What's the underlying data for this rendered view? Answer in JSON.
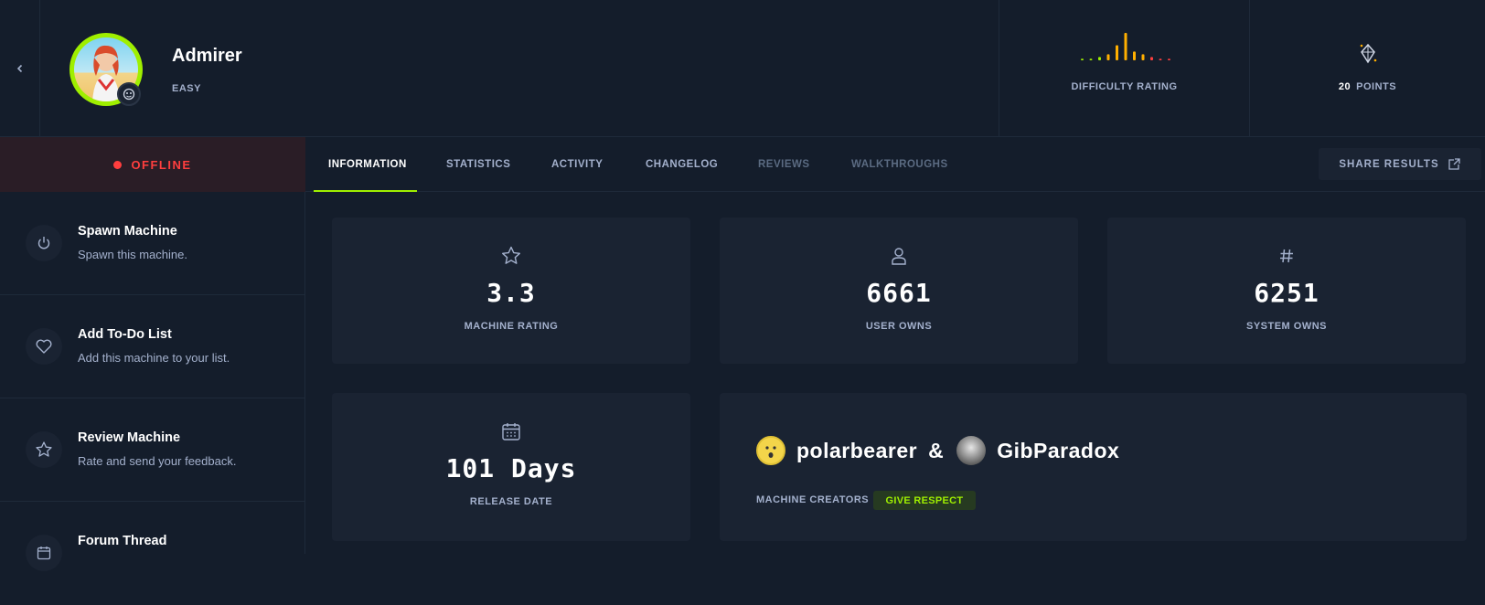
{
  "machine": {
    "name": "Admirer",
    "difficulty": "EASY",
    "difficulty_rating_label": "DIFFICULTY RATING",
    "points_value": "20",
    "points_label": "POINTS",
    "difficulty_bars": [
      {
        "h": 0.06,
        "color": "#9fef00"
      },
      {
        "h": 0.06,
        "color": "#9fef00"
      },
      {
        "h": 0.12,
        "color": "#9fef00"
      },
      {
        "h": 0.22,
        "color": "#ffaf00"
      },
      {
        "h": 0.55,
        "color": "#ffaf00"
      },
      {
        "h": 1.0,
        "color": "#ffaf00"
      },
      {
        "h": 0.32,
        "color": "#ffaf00"
      },
      {
        "h": 0.22,
        "color": "#ffaf00"
      },
      {
        "h": 0.12,
        "color": "#ff3e3e"
      },
      {
        "h": 0.06,
        "color": "#ff3e3e"
      },
      {
        "h": 0.06,
        "color": "#ff3e3e"
      }
    ]
  },
  "status": {
    "label": "OFFLINE",
    "color": "#ff3e3e"
  },
  "actions": [
    {
      "title": "Spawn Machine",
      "subtitle": "Spawn this machine.",
      "icon": "power-icon"
    },
    {
      "title": "Add To-Do List",
      "subtitle": "Add this machine to your list.",
      "icon": "heart-icon"
    },
    {
      "title": "Review Machine",
      "subtitle": "Rate and send your feedback.",
      "icon": "star-icon"
    },
    {
      "title": "Forum Thread",
      "subtitle": "",
      "icon": "calendar-icon"
    }
  ],
  "tabs": [
    {
      "label": "INFORMATION",
      "state": "active"
    },
    {
      "label": "STATISTICS",
      "state": "normal"
    },
    {
      "label": "ACTIVITY",
      "state": "normal"
    },
    {
      "label": "CHANGELOG",
      "state": "normal"
    },
    {
      "label": "REVIEWS",
      "state": "disabled"
    },
    {
      "label": "WALKTHROUGHS",
      "state": "disabled"
    }
  ],
  "share": {
    "label": "SHARE RESULTS",
    "icon": "external-link-icon"
  },
  "stats": [
    {
      "value": "3.3",
      "label": "MACHINE RATING",
      "icon": "star-icon"
    },
    {
      "value": "6661",
      "label": "USER OWNS",
      "icon": "user-icon"
    },
    {
      "value": "6251",
      "label": "SYSTEM OWNS",
      "icon": "hash-icon"
    }
  ],
  "release": {
    "value": "101 Days",
    "label": "RELEASE DATE",
    "icon": "calendar-icon"
  },
  "creators": {
    "first": "polarbearer",
    "separator": "&",
    "second": "GibParadox",
    "label": "MACHINE CREATORS",
    "respect_label": "GIVE RESPECT"
  },
  "colors": {
    "accent": "#9fef00",
    "offline": "#ff3e3e",
    "bg": "#141d2b",
    "card": "#1a2332",
    "muted": "#a4b1cd"
  }
}
